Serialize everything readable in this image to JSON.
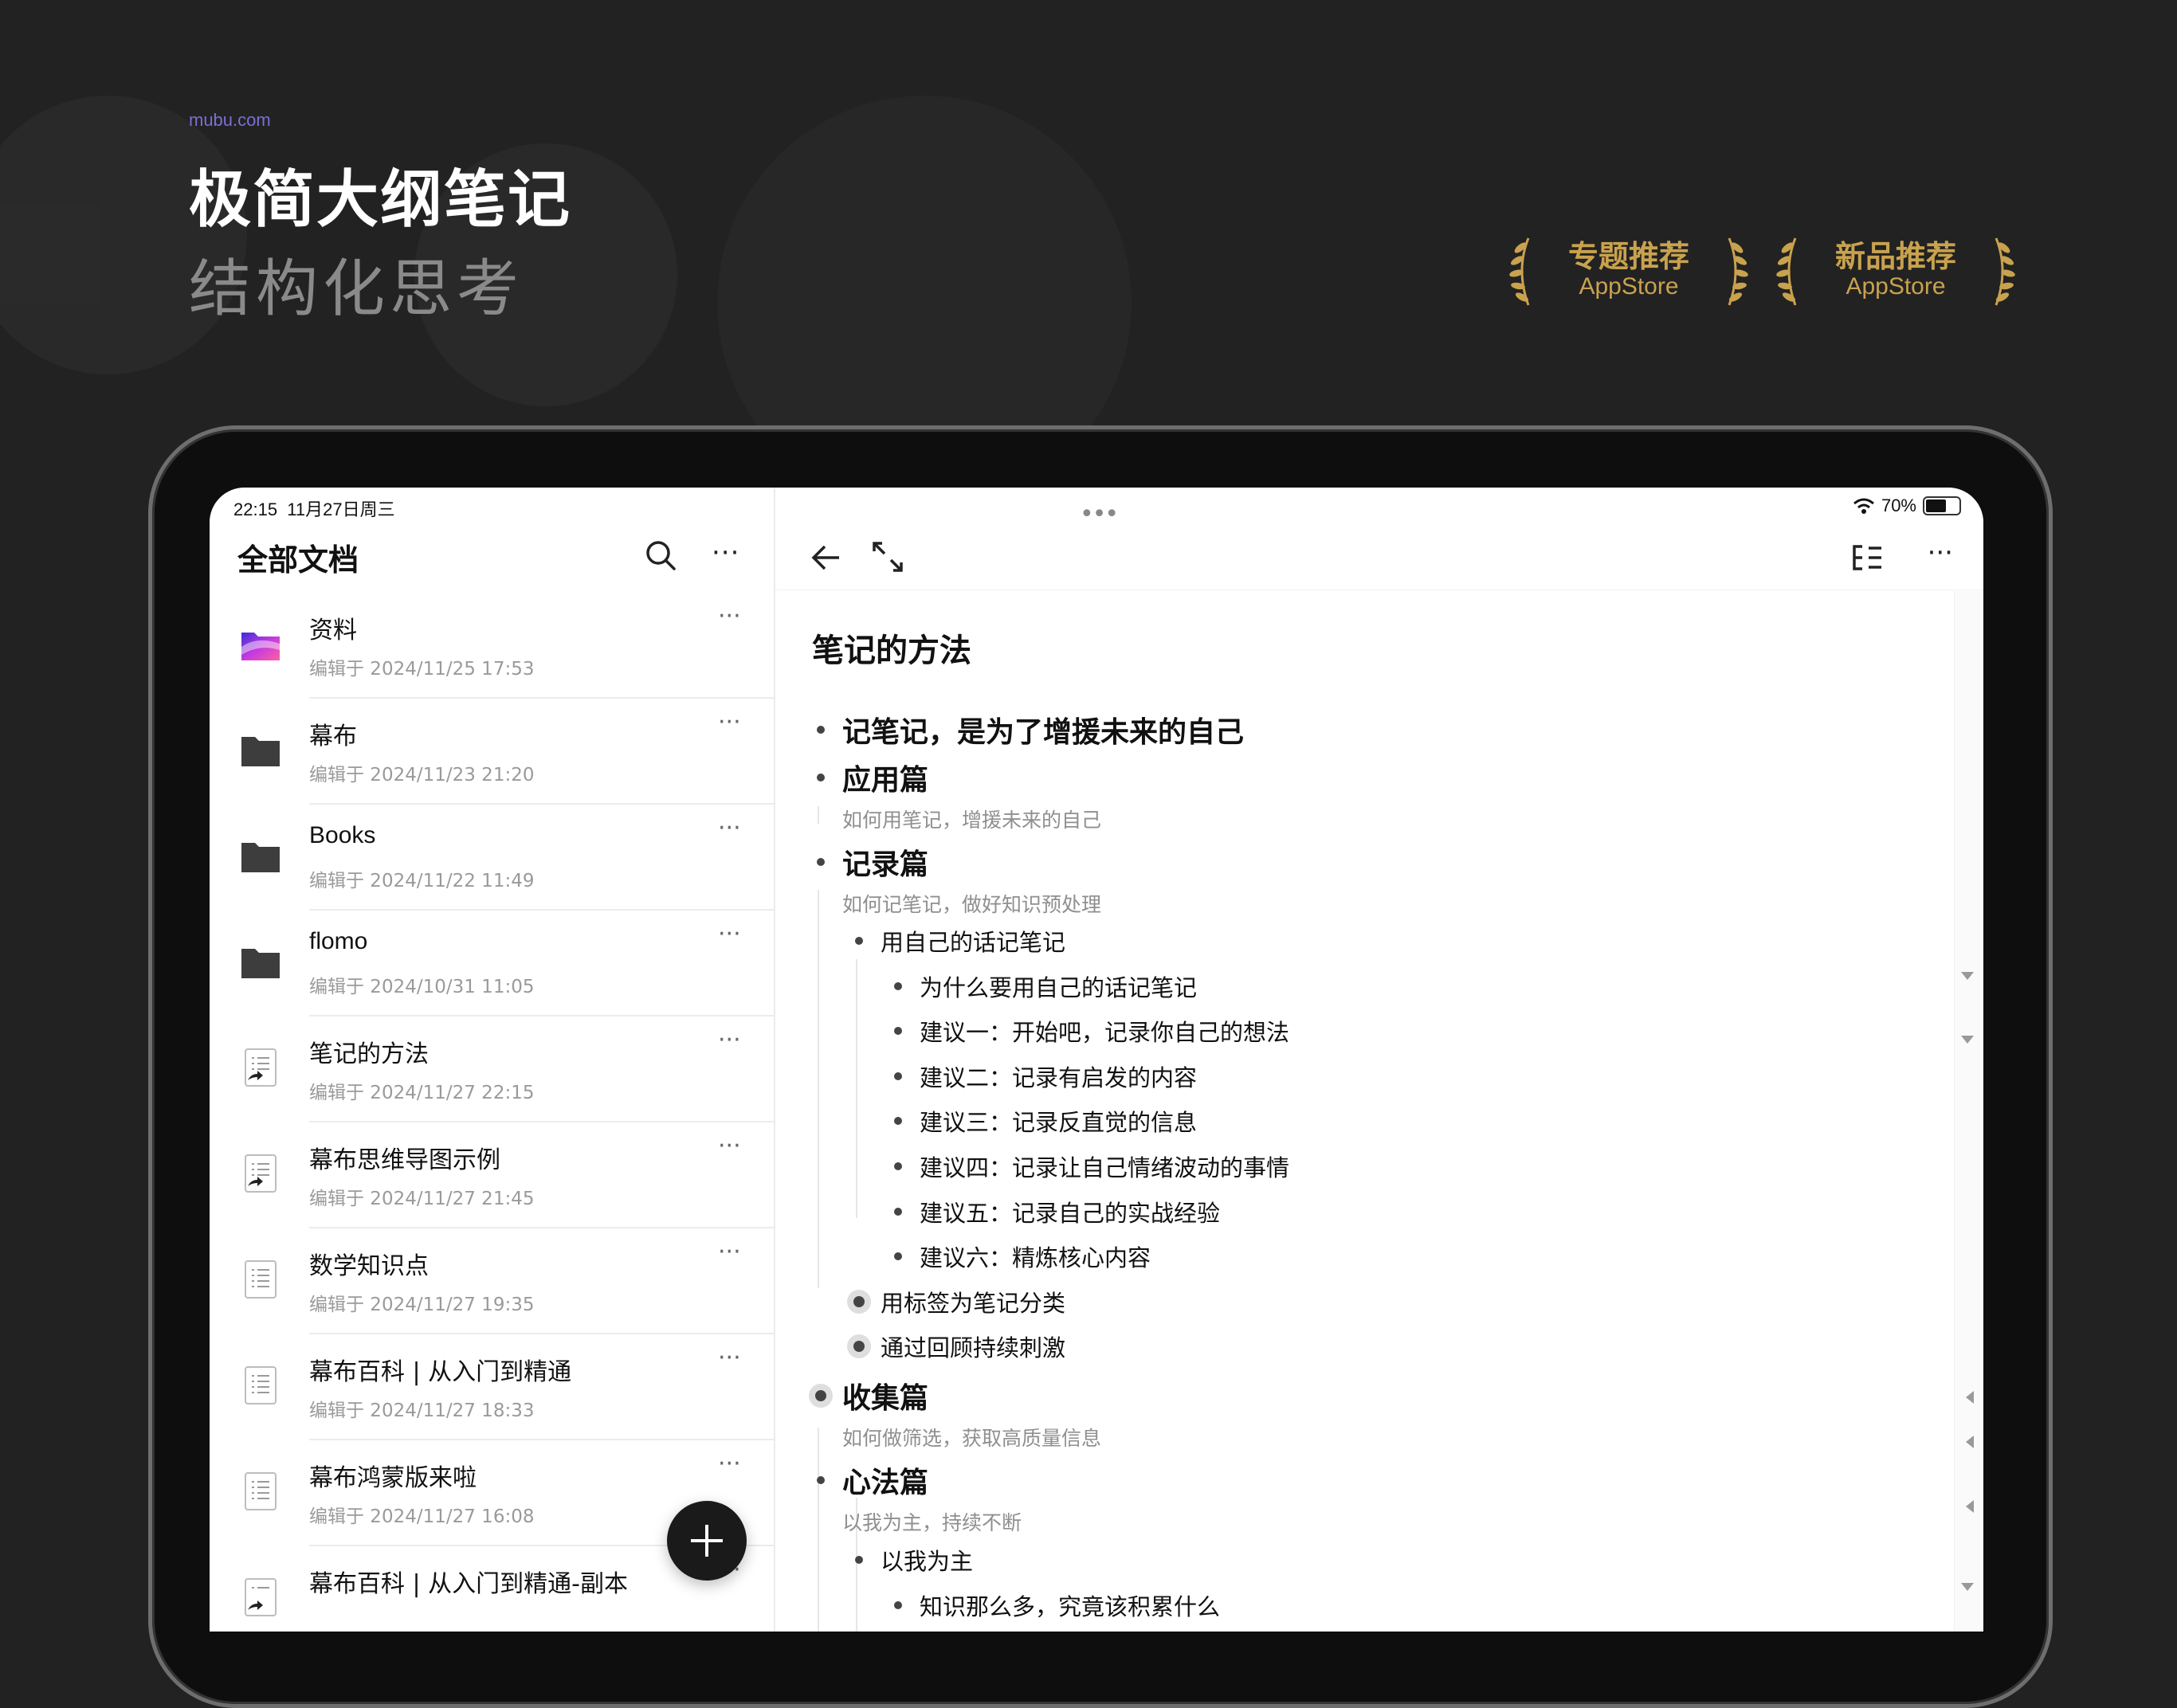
{
  "promo": {
    "site": "mubu.com",
    "title": "极简大纲笔记",
    "subtitle": "结构化思考",
    "awards": [
      {
        "title": "专题推荐",
        "store": "AppStore"
      },
      {
        "title": "新品推荐",
        "store": "AppStore"
      }
    ],
    "accent_color": "#c9a24e"
  },
  "status_bar": {
    "time": "22:15",
    "date": "11月27日周三",
    "battery": "70%",
    "battery_level": 0.7
  },
  "sidebar": {
    "title": "全部文档",
    "items": [
      {
        "name": "资料",
        "time": "编辑于 2024/11/25 17:53",
        "icon": "colorful-folder-icon"
      },
      {
        "name": "幕布",
        "time": "编辑于 2024/11/23 21:20",
        "icon": "folder-icon"
      },
      {
        "name": "Books",
        "time": "编辑于 2024/11/22 11:49",
        "icon": "folder-icon"
      },
      {
        "name": "flomo",
        "time": "编辑于 2024/10/31 11:05",
        "icon": "folder-icon"
      },
      {
        "name": "笔记的方法",
        "time": "编辑于 2024/11/27 22:15",
        "icon": "shared-document-icon"
      },
      {
        "name": "幕布思维导图示例",
        "time": "编辑于 2024/11/27 21:45",
        "icon": "shared-document-icon"
      },
      {
        "name": "数学知识点",
        "time": "编辑于 2024/11/27 19:35",
        "icon": "document-icon"
      },
      {
        "name": "幕布百科 | 从入门到精通",
        "time": "编辑于 2024/11/27 18:33",
        "icon": "document-icon"
      },
      {
        "name": "幕布鸿蒙版来啦",
        "time": "编辑于 2024/11/27 16:08",
        "icon": "document-icon"
      },
      {
        "name": "幕布百科 | 从入门到精通-副本",
        "time": "",
        "icon": "shared-document-icon"
      }
    ]
  },
  "editor": {
    "title": "笔记的方法",
    "nodes": [
      {
        "text": "记笔记，是为了增援未来的自己"
      },
      {
        "text": "应用篇"
      },
      {
        "text": "如何用笔记，增援未来的自己"
      },
      {
        "text": "记录篇"
      },
      {
        "text": "如何记笔记，做好知识预处理"
      },
      {
        "text": "用自己的话记笔记"
      },
      {
        "text": "为什么要用自己的话记笔记"
      },
      {
        "text": "建议一：开始吧，记录你自己的想法"
      },
      {
        "text": "建议二：记录有启发的内容"
      },
      {
        "text": "建议三：记录反直觉的信息"
      },
      {
        "text": "建议四：记录让自己情绪波动的事情"
      },
      {
        "text": "建议五：记录自己的实战经验"
      },
      {
        "text": "建议六：精炼核心内容"
      },
      {
        "text": "用标签为笔记分类"
      },
      {
        "text": "通过回顾持续刺激"
      },
      {
        "text": "收集篇"
      },
      {
        "text": "如何做筛选，获取高质量信息"
      },
      {
        "text": "心法篇"
      },
      {
        "text": "以我为主，持续不断"
      },
      {
        "text": "以我为主"
      },
      {
        "text": "知识那么多，究竟该积累什么"
      }
    ]
  }
}
